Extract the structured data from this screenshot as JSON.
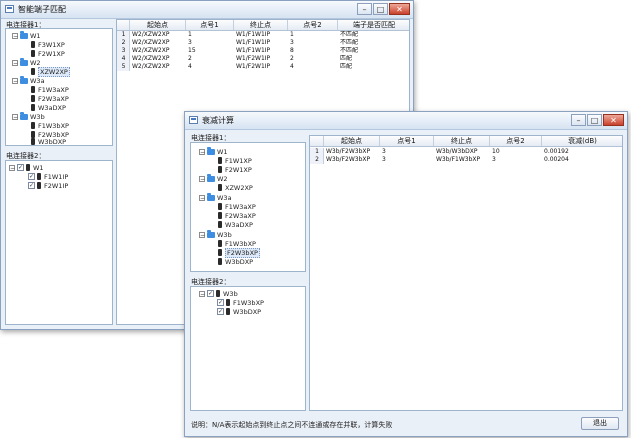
{
  "window1": {
    "title": "智能端子匹配",
    "minimize": "–",
    "maximize": "□",
    "close": "✕",
    "tree1_label": "电连接器1：",
    "tree1": {
      "groups": [
        {
          "name": "W1",
          "items": [
            "F3W1XP",
            "F2W1XP"
          ]
        },
        {
          "name": "W2",
          "items": [
            "XZW2XP"
          ]
        },
        {
          "name": "W3a",
          "items": [
            "F1W3aXP",
            "F2W3aXP",
            "W3aDXP"
          ]
        },
        {
          "name": "W3b",
          "items": [
            "F1W3bXP",
            "F2W3bXP",
            "W3bDXP"
          ]
        }
      ]
    },
    "tree2_label": "电连接器2：",
    "tree2": {
      "root": "W1",
      "items": [
        "F1W1IP",
        "F2W1IP"
      ]
    },
    "table": {
      "headers": [
        "",
        "起始点",
        "点号1",
        "终止点",
        "点号2",
        "端子是否匹配"
      ],
      "rows": [
        [
          "1",
          "W2/XZW2XP",
          "1",
          "W1/F1W1IP",
          "1",
          "不匹配"
        ],
        [
          "2",
          "W2/XZW2XP",
          "3",
          "W1/F1W1IP",
          "3",
          "不匹配"
        ],
        [
          "3",
          "W2/XZW2XP",
          "15",
          "W1/F1W1IP",
          "8",
          "不匹配"
        ],
        [
          "4",
          "W2/XZW2XP",
          "2",
          "W1/F2W1IP",
          "2",
          "匹配"
        ],
        [
          "5",
          "W2/XZW2XP",
          "4",
          "W1/F2W1IP",
          "4",
          "匹配"
        ]
      ]
    }
  },
  "window2": {
    "title": "衰减计算",
    "minimize": "–",
    "maximize": "□",
    "close": "✕",
    "tree1_label": "电连接器1：",
    "tree1": {
      "groups": [
        {
          "name": "W1",
          "items": [
            "F1W1XP",
            "F2W1XP"
          ]
        },
        {
          "name": "W2",
          "items": [
            "XZW2XP"
          ]
        },
        {
          "name": "W3a",
          "items": [
            "F1W3aXP",
            "F2W3aXP",
            "W3aDXP"
          ]
        },
        {
          "name": "W3b",
          "items": [
            "F1W3bXP",
            "F2W3bXP",
            "W3bDXP"
          ]
        }
      ]
    },
    "tree2_label": "电连接器2：",
    "tree2": {
      "root": "W3b",
      "items": [
        "F1W3bXP",
        "W3bDXP"
      ]
    },
    "table": {
      "headers": [
        "",
        "起始点",
        "点号1",
        "终止点",
        "点号2",
        "衰减(dB)"
      ],
      "rows": [
        [
          "1",
          "W3b/F2W3bXP",
          "3",
          "W3b/W3bDXP",
          "10",
          "0.00192"
        ],
        [
          "2",
          "W3b/F2W3bXP",
          "3",
          "W3b/F1W3bXP",
          "3",
          "0.00204"
        ]
      ]
    },
    "status": "说明：N/A表示起始点到终止点之间不连通或存在并联，计算失败",
    "exit_button": "退出"
  }
}
